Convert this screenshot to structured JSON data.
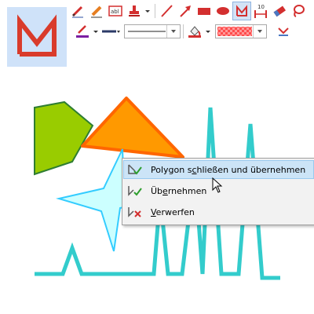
{
  "preview": {
    "icon": "open-polygon-icon"
  },
  "toolbar": {
    "row1": [
      "pen-icon",
      "marker-icon",
      "text-field-icon",
      "stamp-icon",
      "chevron-down-icon",
      "line-icon",
      "arrow-icon",
      "rectangle-icon",
      "ellipse-icon",
      "polygon-icon",
      "measure-icon",
      "eraser-icon",
      "lasso-icon"
    ],
    "measure_badge": "10",
    "row2": [
      "line-color-icon",
      "line-width-icon",
      "line-style-combo",
      "fill-color-icon",
      "fill-pattern-combo",
      "stamp-tool-icon"
    ]
  },
  "context_menu": {
    "items": [
      {
        "label": "Polygon schließen und übernehmen",
        "underline_index": 9,
        "icon": "close-polygon-check-icon",
        "highlighted": true
      },
      {
        "label": "Übernehmen",
        "underline_index": 2,
        "icon": "accept-polyline-check-icon",
        "highlighted": false
      },
      {
        "label": "Verwerfen",
        "underline_index": 0,
        "icon": "discard-polyline-x-icon",
        "highlighted": false
      }
    ]
  },
  "colors": {
    "accent_red": "#d32f2f",
    "polygon_green": "#99cc00",
    "polygon_orange": "#ff9900",
    "star_fill": "#ccffff",
    "star_stroke": "#33ccff",
    "polyline": "#33cccc",
    "menu_highlight": "#cce4f7"
  }
}
